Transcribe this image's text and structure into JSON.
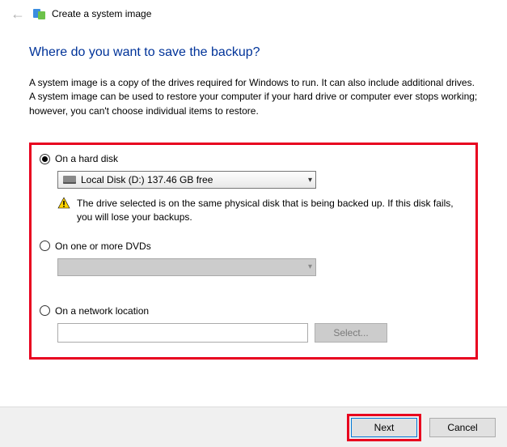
{
  "header": {
    "window_title": "Create a system image"
  },
  "page": {
    "title": "Where do you want to save the backup?",
    "description": "A system image is a copy of the drives required for Windows to run. It can also include additional drives. A system image can be used to restore your computer if your hard drive or computer ever stops working; however, you can't choose individual items to restore."
  },
  "options": {
    "hard_disk": {
      "label": "On a hard disk",
      "selected_drive": "Local Disk (D:)  137.46 GB free",
      "warning": "The drive selected is on the same physical disk that is being backed up. If this disk fails, you will lose your backups."
    },
    "dvd": {
      "label": "On one or more DVDs"
    },
    "network": {
      "label": "On a network location",
      "value": "",
      "select_button": "Select..."
    }
  },
  "footer": {
    "next": "Next",
    "cancel": "Cancel"
  }
}
